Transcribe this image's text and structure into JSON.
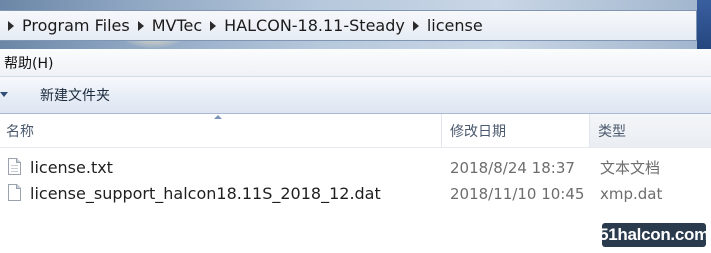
{
  "breadcrumb": {
    "items": [
      "Program Files",
      "MVTec",
      "HALCON-18.11-Steady",
      "license"
    ]
  },
  "menu": {
    "help": "帮助(H)"
  },
  "toolbar": {
    "new_folder": "新建文件夹"
  },
  "columns": {
    "name": "名称",
    "date_modified": "修改日期",
    "type": "类型"
  },
  "files": [
    {
      "name": "license.txt",
      "date_modified": "2018/8/24 18:37",
      "type": "文本文档",
      "icon": "text-file-icon"
    },
    {
      "name": "license_support_halcon18.11S_2018_12.dat",
      "date_modified": "2018/11/10 10:45",
      "type": "xmp.dat",
      "icon": "file-icon"
    }
  ],
  "watermark": "51halcon.com",
  "colors": {
    "address_bar_border": "#7f95b1",
    "toolbar_text": "#1c2a3d",
    "header_text": "#4b5a6e",
    "meta_text": "#6d6d6d"
  }
}
